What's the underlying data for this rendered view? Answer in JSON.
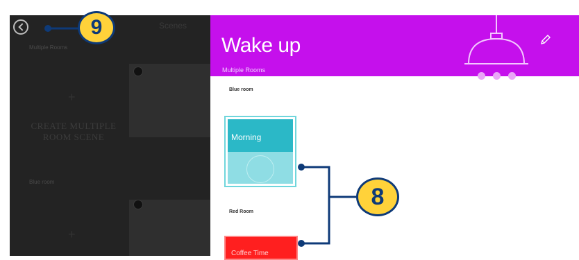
{
  "colors": {
    "header_bg": "#c510ec",
    "scene_teal": "#2bb8c7",
    "scene_red": "#ff1f1f",
    "callout_fill": "#ffd23a",
    "callout_line": "#0e3a78",
    "left_panel_bg": "#232323"
  },
  "left_panel": {
    "back_icon": "back-arrow-circle-icon",
    "top_label": "Scenes",
    "section_multiple": "Multiple Rooms",
    "create_text": "CREATE MULTIPLE ROOM SCENE",
    "section_blue": "Blue room"
  },
  "scene_panel": {
    "title": "Wake up",
    "subtitle": "Multiple Rooms",
    "edit_icon": "pencil-icon",
    "lamp_icon": "ceiling-lamp-icon",
    "rooms": [
      {
        "label": "Blue room",
        "scene_name": "Morning"
      },
      {
        "label": "Red Room",
        "scene_name": "Coffee Time"
      }
    ]
  },
  "callouts": {
    "nine": "9",
    "eight": "8"
  }
}
